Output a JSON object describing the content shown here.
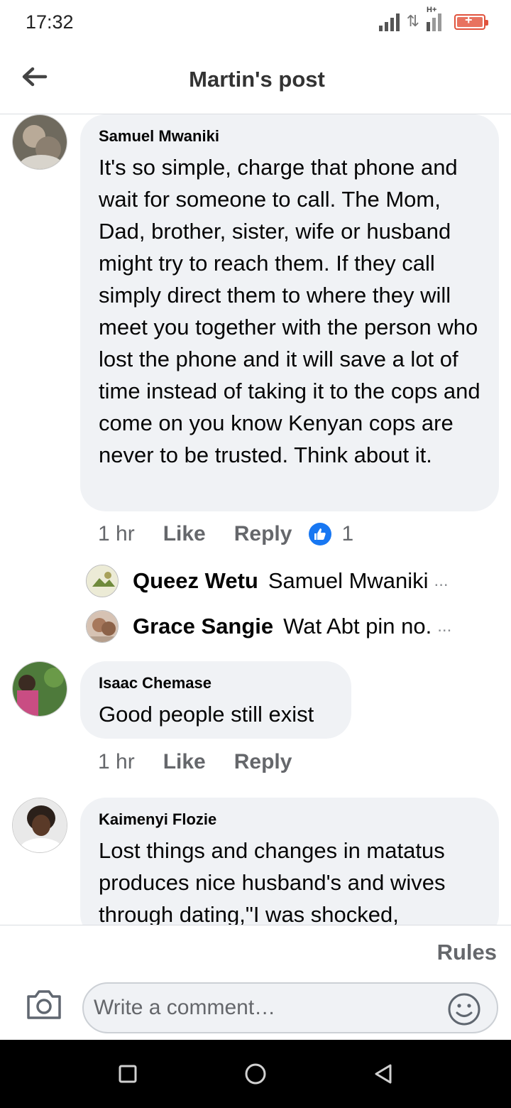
{
  "status_bar": {
    "time": "17:32"
  },
  "header": {
    "title": "Martin's post"
  },
  "comments": [
    {
      "author": "Samuel Mwaniki",
      "text": "It's so simple, charge that phone and wait for someone to call. The Mom, Dad, brother, sister, wife or husband might try to reach them. If they call simply direct them to where they will meet you together with the person who lost the phone and it will save a lot of time instead of taking it to the cops and come on you know Kenyan cops are never to be trusted. Think about it.",
      "time": "1 hr",
      "like_label": "Like",
      "reply_label": "Reply",
      "reaction_count": "1",
      "replies": [
        {
          "name": "Queez Wetu",
          "text": "Samuel Mwaniki",
          "ellipsis": "..."
        },
        {
          "name": "Grace Sangie",
          "text": "Wat Abt  pin no.",
          "ellipsis": "..."
        }
      ]
    },
    {
      "author": "Isaac Chemase",
      "text": "Good people still exist",
      "time": "1 hr",
      "like_label": "Like",
      "reply_label": "Reply"
    },
    {
      "author": "Kaimenyi Flozie",
      "text": "Lost things and changes in matatus produces nice husband's and wives through dating,\"I was shocked,"
    }
  ],
  "composer": {
    "rules_label": "Rules",
    "placeholder": "Write a comment…"
  },
  "colors": {
    "accent": "#1877f2",
    "bubble": "#f0f2f5",
    "muted": "#65676b"
  },
  "icons": [
    "back-arrow-icon",
    "like-reaction-icon",
    "camera-icon",
    "emoji-icon",
    "nav-square-icon",
    "nav-circle-icon",
    "nav-triangle-icon"
  ]
}
